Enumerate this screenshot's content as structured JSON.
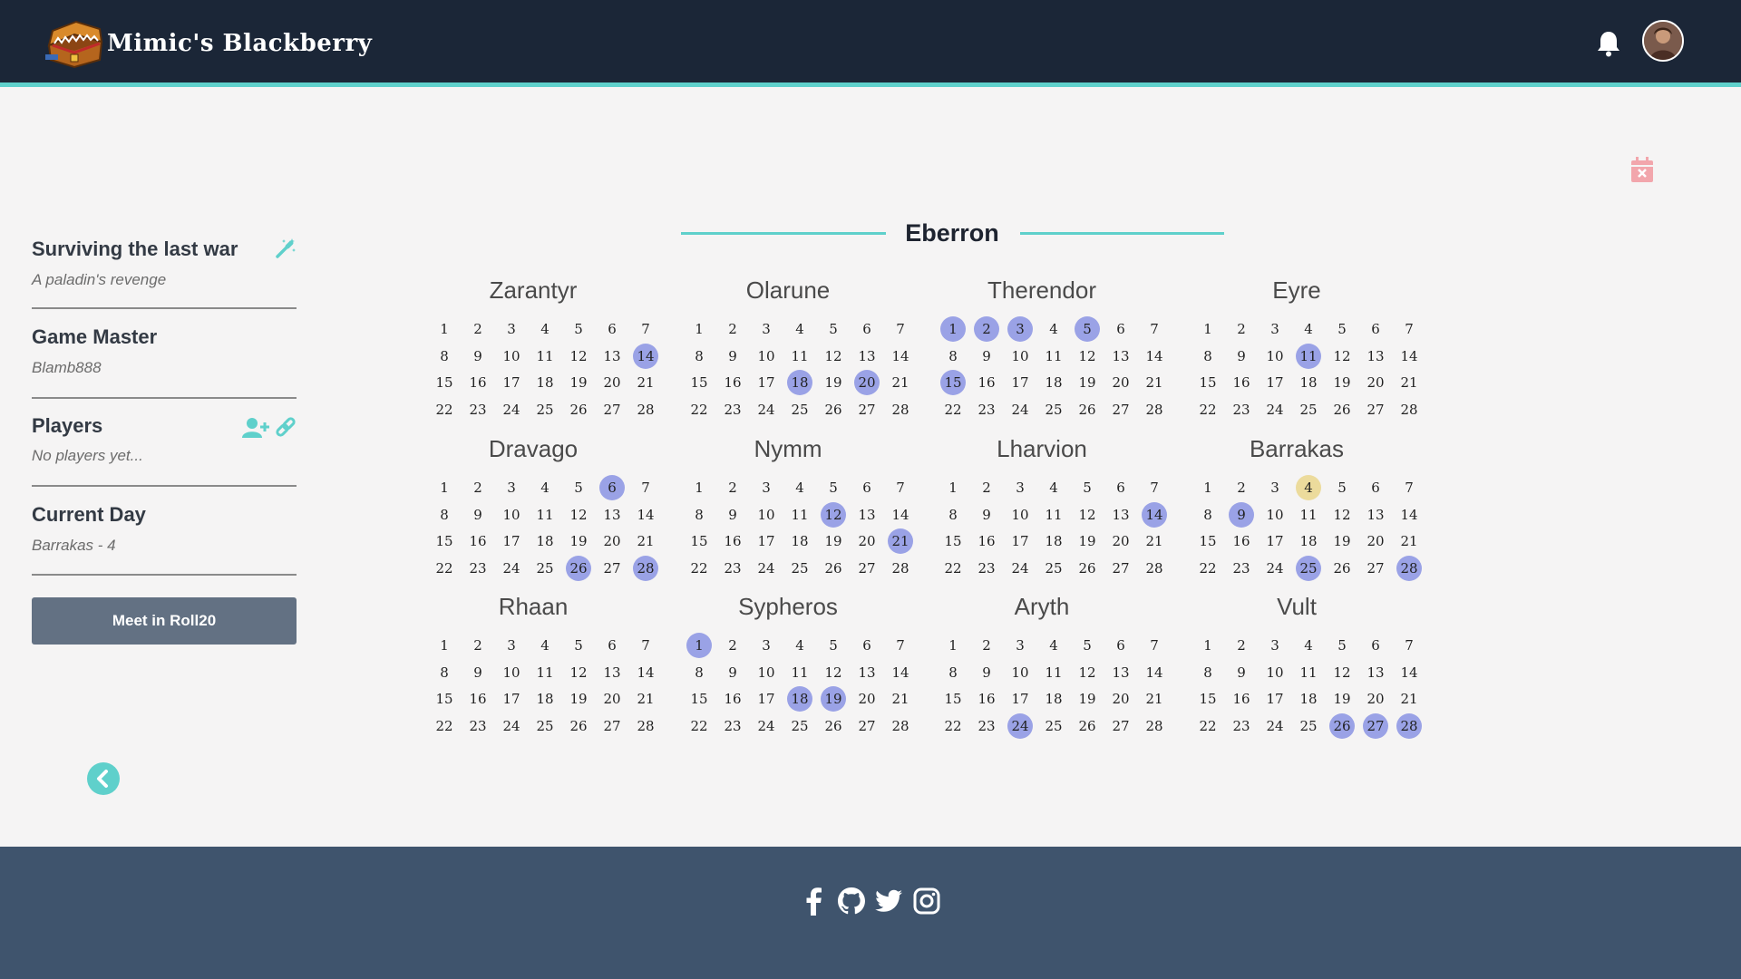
{
  "header": {
    "app_name": "Mimic's Blackberry",
    "icons": [
      "treasure-chest-mimic-logo",
      "bell-icon",
      "user-avatar"
    ]
  },
  "sidebar": {
    "campaign": {
      "title": "Surviving the last war",
      "subtitle": "A paladin's revenge",
      "icon": "magic-wand-icon"
    },
    "game_master": {
      "title": "Game Master",
      "value": "Blamb888"
    },
    "players": {
      "title": "Players",
      "value": "No players yet...",
      "icons": [
        "user-plus-icon",
        "link-icon"
      ]
    },
    "current_day": {
      "title": "Current Day",
      "value": "Barrakas - 4"
    },
    "meet_button": "Meet in Roll20",
    "back_icon": "chevron-left-circle-icon"
  },
  "calendar": {
    "title": "Eberron",
    "delete_icon": "calendar-x-icon",
    "days_per_month": 28,
    "months": [
      {
        "name": "Zarantyr",
        "marked": [
          14
        ]
      },
      {
        "name": "Olarune",
        "marked": [
          18,
          20
        ]
      },
      {
        "name": "Therendor",
        "marked": [
          1,
          2,
          3,
          5,
          15
        ]
      },
      {
        "name": "Eyre",
        "marked": [
          11
        ]
      },
      {
        "name": "Dravago",
        "marked": [
          6,
          26,
          28
        ]
      },
      {
        "name": "Nymm",
        "marked": [
          12,
          21
        ]
      },
      {
        "name": "Lharvion",
        "marked": [
          14
        ]
      },
      {
        "name": "Barrakas",
        "marked": [
          9,
          25,
          28
        ],
        "current": 4
      },
      {
        "name": "Rhaan",
        "marked": []
      },
      {
        "name": "Sypheros",
        "marked": [
          1,
          18,
          19
        ]
      },
      {
        "name": "Aryth",
        "marked": [
          24
        ]
      },
      {
        "name": "Vult",
        "marked": [
          26,
          27,
          28
        ]
      }
    ],
    "colors": {
      "marked": "#9aa2e6",
      "current": "#ecdb9c",
      "accent": "#5fd0cb"
    }
  },
  "footer": {
    "icons": [
      "facebook-icon",
      "github-icon",
      "twitter-icon",
      "instagram-icon"
    ]
  }
}
